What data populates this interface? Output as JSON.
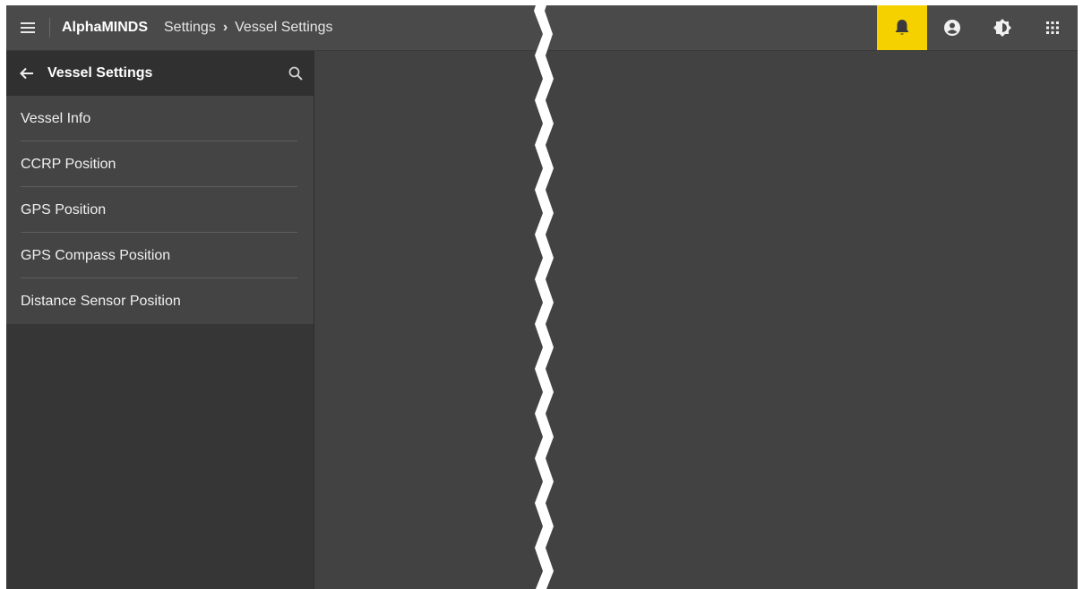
{
  "header": {
    "app_name": "AlphaMINDS",
    "breadcrumb": [
      "Settings",
      "Vessel Settings"
    ],
    "breadcrumb_separator": "›",
    "icons": [
      "menu-icon",
      "bell-icon",
      "account-icon",
      "brightness-icon",
      "apps-grid-icon"
    ],
    "bell_highlight_color": "#f5d100"
  },
  "sidebar": {
    "title": "Vessel Settings",
    "items": [
      {
        "label": "Vessel Info"
      },
      {
        "label": "CCRP Position"
      },
      {
        "label": "GPS Position"
      },
      {
        "label": "GPS Compass Position"
      },
      {
        "label": "Distance Sensor Position"
      }
    ]
  },
  "colors": {
    "topbar": "#4a4a4a",
    "sidebar_header": "#303030",
    "sidebar_list": "#444444",
    "content": "#424242"
  }
}
